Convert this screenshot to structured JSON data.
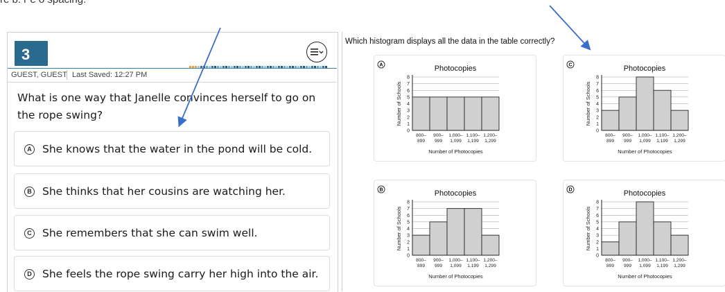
{
  "top_fragment": "re b. r e o spacing.",
  "question": {
    "number": "3",
    "user": "GUEST, GUEST",
    "last_saved": "Last Saved: 12:27 PM",
    "text": "What is one way that Janelle convinces herself to go on the rope swing?",
    "options": [
      {
        "letter": "A",
        "text": "She knows that the water in the pond will be cold."
      },
      {
        "letter": "B",
        "text": "She thinks that her cousins are watching her."
      },
      {
        "letter": "C",
        "text": "She remembers that she can swim well."
      },
      {
        "letter": "D",
        "text": "She feels the rope swing carry her high into the air."
      }
    ]
  },
  "right": {
    "prompt": "Which histogram displays all the data in the table correctly?"
  },
  "colors": {
    "badge": "#2a6a8f",
    "bar_fill": "#d0d0d0",
    "arrow": "#3a6fc9",
    "accent": "#3f7ea8"
  },
  "icons": [
    "menu-icon",
    "option-letter-icon"
  ],
  "chart_data": [
    {
      "type": "bar",
      "letter": "A",
      "title": "Photocopies",
      "xlabel": "Number of Photocopies",
      "ylabel": "Number of Schools",
      "categories": [
        "800–\n899",
        "900–\n999",
        "1,000–\n1,099",
        "1,100–\n1,199",
        "1,200–\n1,299"
      ],
      "values": [
        5,
        5,
        5,
        5,
        5
      ],
      "ylim": [
        0,
        8
      ],
      "yticks": [
        0,
        1,
        2,
        3,
        4,
        5,
        6,
        7,
        8
      ],
      "grid": true
    },
    {
      "type": "bar",
      "letter": "C",
      "title": "Photocopies",
      "xlabel": "Number of Photocopies",
      "ylabel": "Number of Schools",
      "categories": [
        "800–\n899",
        "900–\n999",
        "1,000–\n1,099",
        "1,100–\n1,199",
        "1,200–\n1,299"
      ],
      "values": [
        3,
        5,
        8,
        6,
        3
      ],
      "ylim": [
        0,
        8
      ],
      "yticks": [
        0,
        1,
        2,
        3,
        4,
        5,
        6,
        7,
        8
      ],
      "grid": true
    },
    {
      "type": "bar",
      "letter": "B",
      "title": "Photocopies",
      "xlabel": "Number of Photocopies",
      "ylabel": "Number of Schools",
      "categories": [
        "800–\n899",
        "900–\n999",
        "1,000–\n1,099",
        "1,100–\n1,199",
        "1,200–\n1,299"
      ],
      "values": [
        3,
        5,
        7,
        7,
        3
      ],
      "ylim": [
        0,
        8
      ],
      "yticks": [
        0,
        1,
        2,
        3,
        4,
        5,
        6,
        7,
        8
      ],
      "grid": true
    },
    {
      "type": "bar",
      "letter": "D",
      "title": "Photocopies",
      "xlabel": "Number of Photocopies",
      "ylabel": "Number of Schools",
      "categories": [
        "800–\n899",
        "900–\n999",
        "1,000–\n1,099",
        "1,100–\n1,199",
        "1,200–\n1,299"
      ],
      "values": [
        2,
        5,
        8,
        5,
        3
      ],
      "ylim": [
        0,
        8
      ],
      "yticks": [
        0,
        1,
        2,
        3,
        4,
        5,
        6,
        7,
        8
      ],
      "grid": true
    }
  ]
}
